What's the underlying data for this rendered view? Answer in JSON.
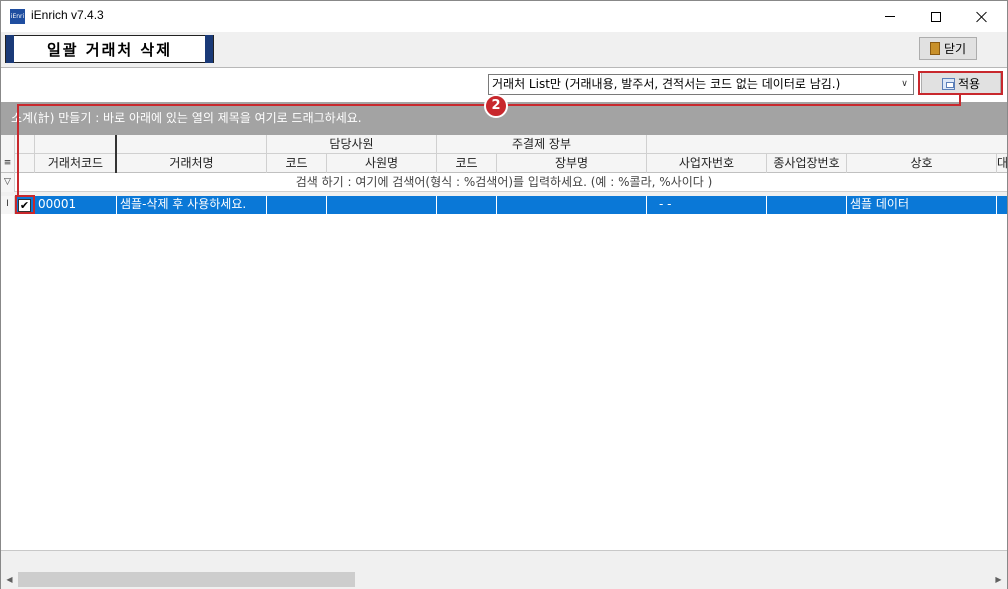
{
  "window": {
    "title": "iEnrich v7.4.3",
    "app_icon_text": "iEnri"
  },
  "header": {
    "page_title": "일괄 거래처 삭제",
    "close_label": "닫기"
  },
  "toolbar": {
    "filter_value": "거래처 List만 (거래내용, 발주서, 견적서는 코드 없는 데이터로 남김.)",
    "apply_label": "적용"
  },
  "annotation": {
    "badge": "2"
  },
  "groupband": {
    "text": "소계(計) 만들기 : 바로 아래에 있는 열의 제목을 여기로 드래그하세요."
  },
  "grid": {
    "group_headers": {
      "manager": "담당사원",
      "ledger": "주결제 장부"
    },
    "columns": {
      "code": "거래처코드",
      "name": "거래처명",
      "mgr_code": "코드",
      "mgr_name": "사원명",
      "ledger_code": "코드",
      "ledger_name": "장부명",
      "biz_no": "사업자번호",
      "sub_biz_no": "종사업장번호",
      "company": "상호",
      "overflow": "대"
    },
    "search_hint": "검색 하기 : 여기에 검색어(형식 : %검색어)를 입력하세요. (예 : %콜라, %사이다 )",
    "row": {
      "checked": "✔",
      "code": "00001",
      "name": "샘플-삭제 후 사용하세요.",
      "biz_no": "-  -",
      "company": "샘플 데이터"
    }
  },
  "colors": {
    "selection": "#0a78d7",
    "annotation": "#c8282d",
    "group_band": "#a3a3a3"
  }
}
